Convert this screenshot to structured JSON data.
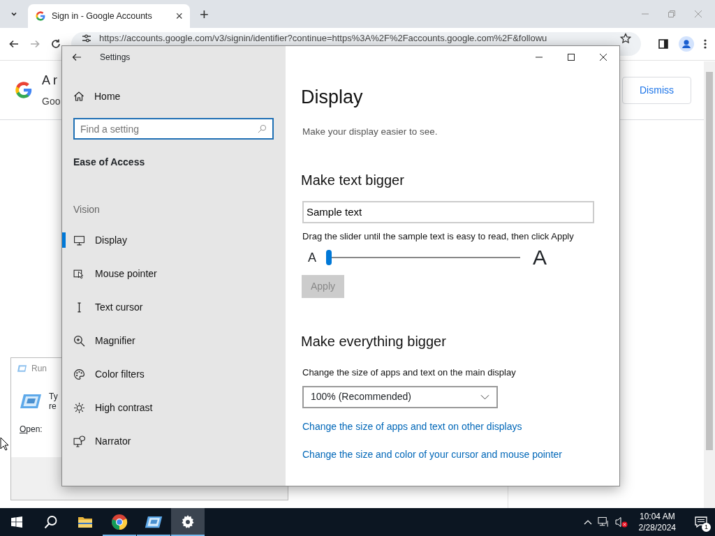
{
  "browser": {
    "tab": {
      "title": "Sign in - Google Accounts",
      "close": "×"
    },
    "new_tab": "+",
    "address": "https://accounts.google.com/v3/signin/identifier?continue=https%3A%2F%2Faccounts.google.com%2F&followu",
    "page": {
      "heading": "A r",
      "subtext": "Goo",
      "dismiss": "Dismiss"
    }
  },
  "run_dialog": {
    "title": "Run",
    "text_line_1": "Ty",
    "text_line_2": "re",
    "open_label": "Open:"
  },
  "settings": {
    "title": "Settings",
    "sidebar": {
      "home": "Home",
      "search_placeholder": "Find a setting",
      "section": "Ease of Access",
      "group": "Vision",
      "items": [
        {
          "label": "Display",
          "kind": "display",
          "selected": true
        },
        {
          "label": "Mouse pointer",
          "kind": "pointer",
          "selected": false
        },
        {
          "label": "Text cursor",
          "kind": "cursor",
          "selected": false
        },
        {
          "label": "Magnifier",
          "kind": "magnifier",
          "selected": false
        },
        {
          "label": "Color filters",
          "kind": "palette",
          "selected": false
        },
        {
          "label": "High contrast",
          "kind": "sun",
          "selected": false
        },
        {
          "label": "Narrator",
          "kind": "narrator",
          "selected": false
        }
      ]
    },
    "content": {
      "title": "Display",
      "subtitle": "Make your display easier to see.",
      "text_section": {
        "heading": "Make text bigger",
        "sample": "Sample text",
        "hint": "Drag the slider until the sample text is easy to read, then click Apply",
        "small_label": "A",
        "large_label": "A",
        "slider": {
          "level": 0
        },
        "apply": {
          "label": "Apply",
          "disabled": true
        }
      },
      "size_section": {
        "heading": "Make everything bigger",
        "label": "Change the size of apps and text on the main display",
        "dropdown": "100% (Recommended)",
        "links": [
          "Change the size of apps and text on other displays",
          "Change the size and color of your cursor and mouse pointer"
        ]
      }
    }
  },
  "taskbar": {
    "apps": [
      {
        "kind": "start",
        "running": false,
        "selected": false
      },
      {
        "kind": "search",
        "running": false,
        "selected": false
      },
      {
        "kind": "folder",
        "running": false,
        "selected": false
      },
      {
        "kind": "chrome",
        "running": true,
        "selected": false
      },
      {
        "kind": "run",
        "running": true,
        "selected": false
      },
      {
        "kind": "gear",
        "running": true,
        "selected": true
      }
    ],
    "time": "10:04 AM",
    "date": "2/28/2024",
    "notifications": "1"
  }
}
